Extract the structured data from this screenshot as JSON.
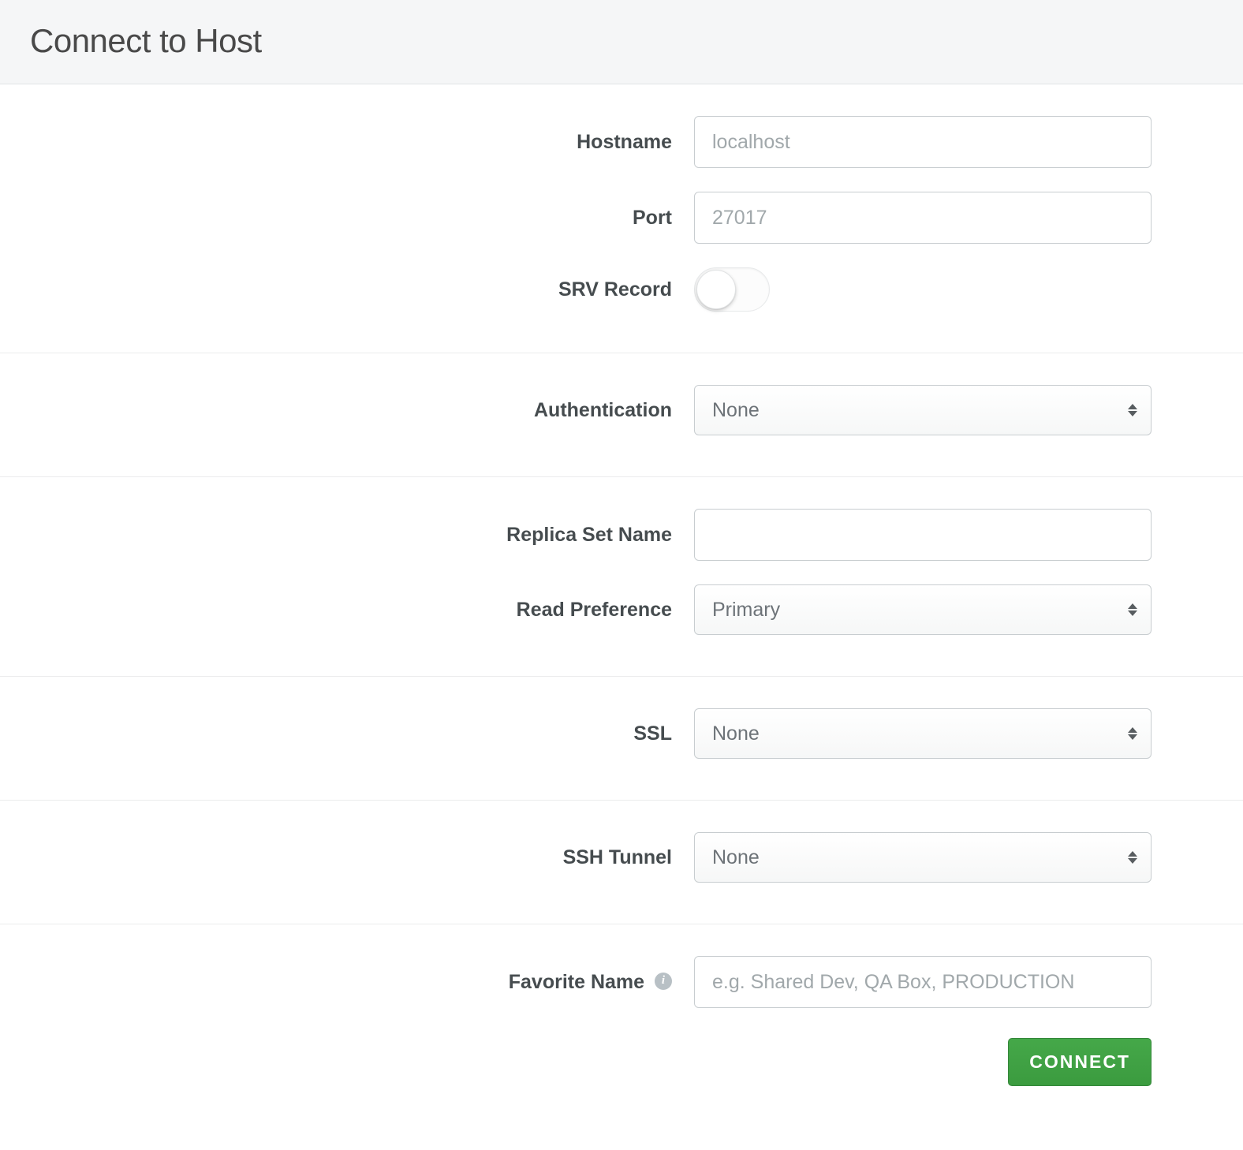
{
  "header": {
    "title": "Connect to Host"
  },
  "fields": {
    "hostname": {
      "label": "Hostname",
      "placeholder": "localhost",
      "value": ""
    },
    "port": {
      "label": "Port",
      "placeholder": "27017",
      "value": ""
    },
    "srv_record": {
      "label": "SRV Record",
      "value": false
    },
    "authentication": {
      "label": "Authentication",
      "value": "None"
    },
    "replica_set_name": {
      "label": "Replica Set Name",
      "placeholder": "",
      "value": ""
    },
    "read_preference": {
      "label": "Read Preference",
      "value": "Primary"
    },
    "ssl": {
      "label": "SSL",
      "value": "None"
    },
    "ssh_tunnel": {
      "label": "SSH Tunnel",
      "value": "None"
    },
    "favorite_name": {
      "label": "Favorite Name",
      "placeholder": "e.g. Shared Dev, QA Box, PRODUCTION",
      "value": ""
    }
  },
  "buttons": {
    "connect": "CONNECT"
  }
}
